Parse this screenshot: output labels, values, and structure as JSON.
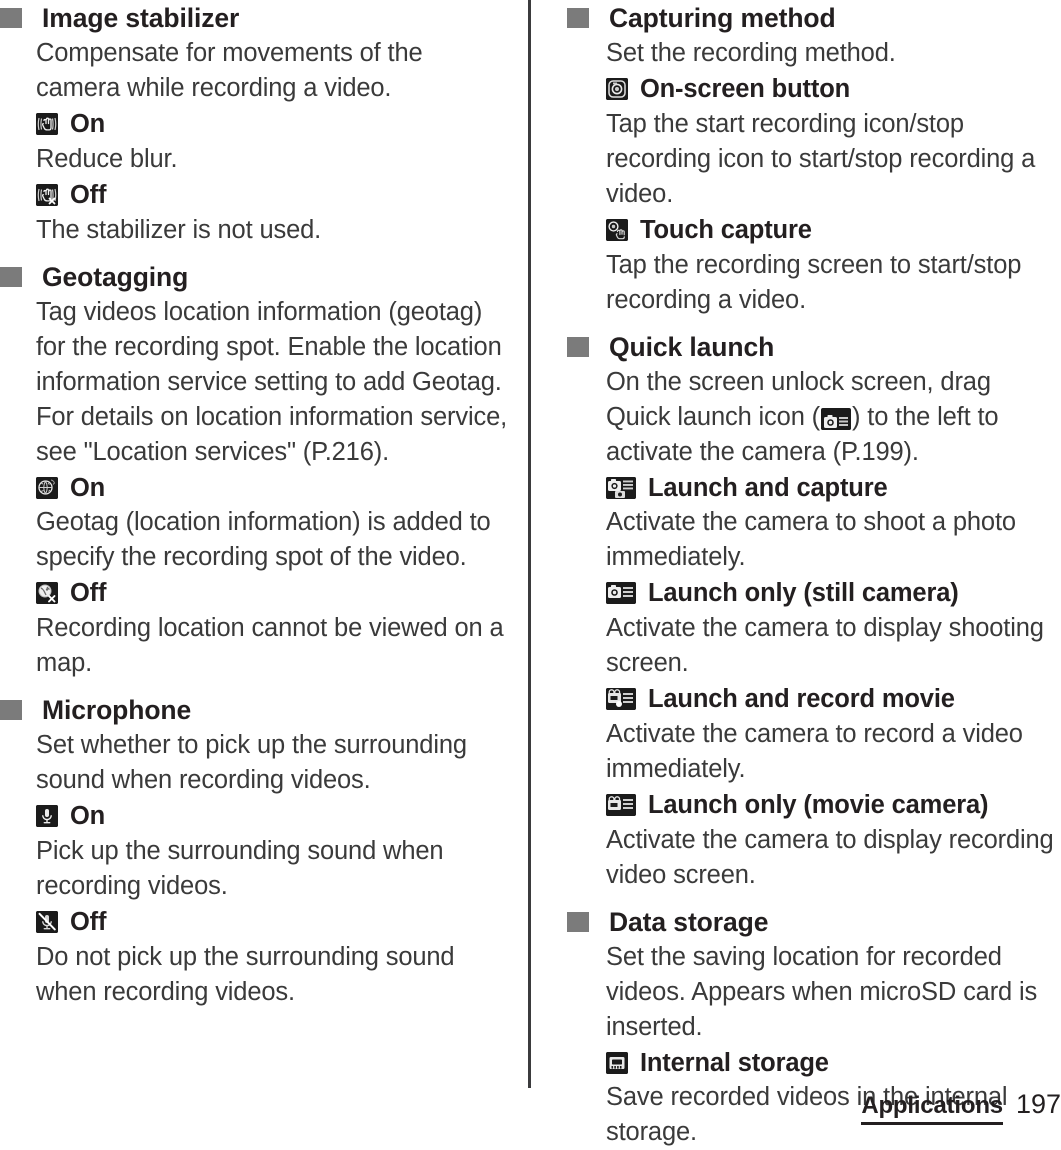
{
  "page": {
    "number": "197",
    "chapter": "Applications"
  },
  "left_column": {
    "sections": [
      {
        "title": "Image stabilizer",
        "description": "Compensate for movements of the camera while recording a video.",
        "options": [
          {
            "icon": "hand-stabilizer-on-icon",
            "label": "On",
            "description": "Reduce blur."
          },
          {
            "icon": "hand-stabilizer-off-icon",
            "label": "Off",
            "description": "The stabilizer is not used."
          }
        ]
      },
      {
        "title": "Geotagging",
        "description": "Tag videos location information (geotag) for the recording spot. Enable the location information service setting to add Geotag. For details on location information service, see \"Location services\" (P.216).",
        "options": [
          {
            "icon": "globe-geotag-on-icon",
            "label": "On",
            "description": "Geotag (location information) is added to specify the recording spot of the video."
          },
          {
            "icon": "globe-geotag-off-icon",
            "label": "Off",
            "description": "Recording location cannot be viewed on a map."
          }
        ]
      },
      {
        "title": "Microphone",
        "description": "Set whether to pick up the surrounding sound when recording videos.",
        "options": [
          {
            "icon": "microphone-on-icon",
            "label": "On",
            "description": "Pick up the surrounding sound when recording videos."
          },
          {
            "icon": "microphone-off-icon",
            "label": "Off",
            "description": "Do not pick up the surrounding sound when recording videos."
          }
        ]
      }
    ]
  },
  "right_column": {
    "sections": [
      {
        "title": "Capturing method",
        "description": "Set the recording method.",
        "options": [
          {
            "icon": "on-screen-button-icon",
            "label": "On-screen button",
            "description": "Tap the start recording icon/stop recording icon to start/stop recording a video."
          },
          {
            "icon": "touch-capture-icon",
            "label": "Touch capture",
            "description": "Tap the recording screen to start/stop recording a video."
          }
        ]
      },
      {
        "title": "Quick launch",
        "description_part1": "On the screen unlock screen, drag Quick launch icon (",
        "inline_icon": "quick-launch-camera-icon",
        "description_part2": ") to the left to activate the camera (P.199).",
        "options": [
          {
            "icon": "launch-and-capture-icon",
            "label": "Launch and capture",
            "description": "Activate the camera to shoot a photo immediately."
          },
          {
            "icon": "launch-only-still-camera-icon",
            "label": "Launch only (still camera)",
            "description": "Activate the camera to display shooting screen."
          },
          {
            "icon": "launch-and-record-movie-icon",
            "label": "Launch and record movie",
            "description": "Activate the camera to record a video immediately."
          },
          {
            "icon": "launch-only-movie-camera-icon",
            "label": "Launch only (movie camera)",
            "description": "Activate the camera to display recording video screen."
          }
        ]
      },
      {
        "title": "Data storage",
        "description": "Set the saving location for recorded videos. Appears when microSD card is inserted.",
        "options": [
          {
            "icon": "internal-storage-chip-icon",
            "label": "Internal storage",
            "description": "Save recorded videos in the internal storage."
          }
        ]
      }
    ]
  }
}
